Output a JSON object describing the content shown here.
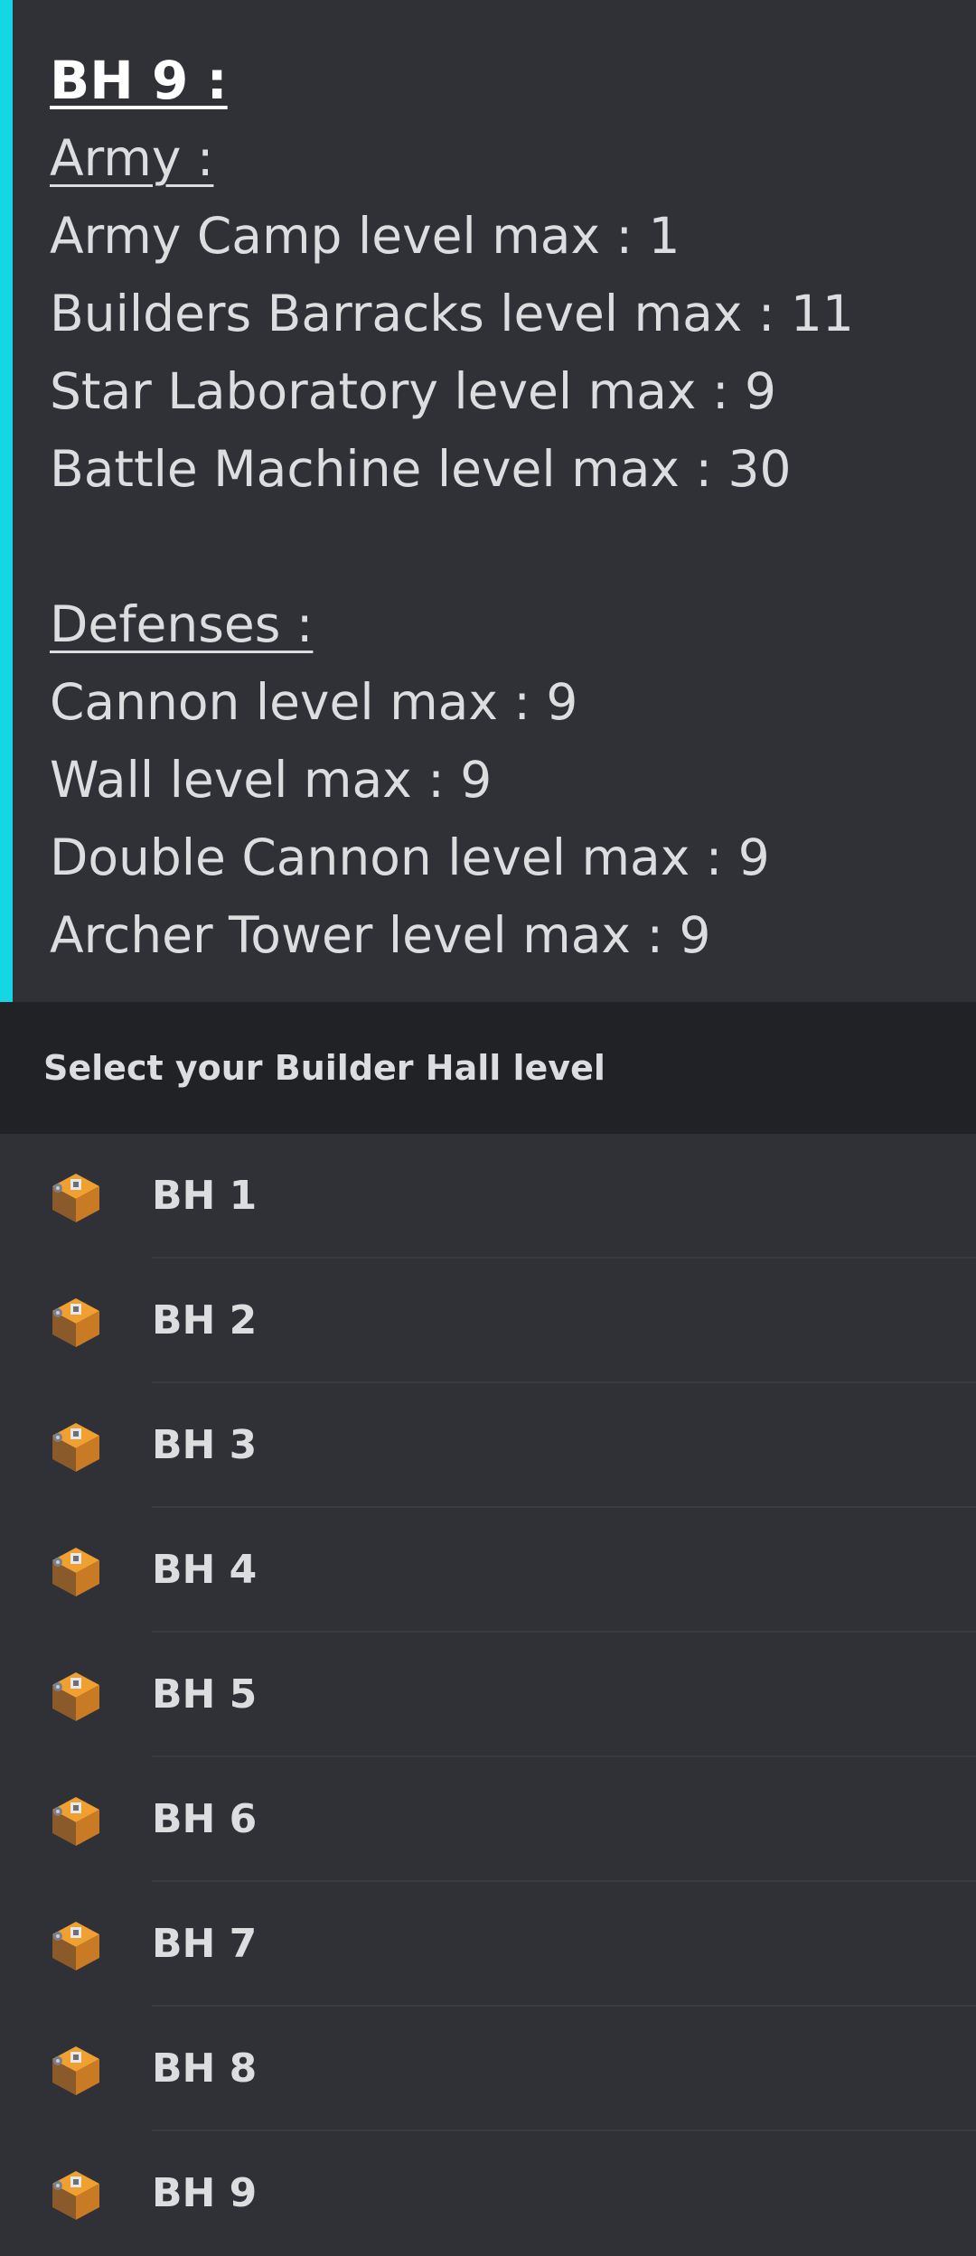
{
  "embed": {
    "accent_color": "#14d6e4",
    "title": "BH 9 :",
    "army_heading": "Army :",
    "army_lines": [
      "Army Camp level max : 1",
      "Builders Barracks level max : 11",
      "Star Laboratory level max : 9",
      "Battle Machine level max : 30"
    ],
    "defenses_heading": "Defenses :",
    "defense_lines": [
      "Cannon level max : 9",
      "Wall level max : 9",
      "Double Cannon level max : 9",
      "Archer Tower level max : 9"
    ]
  },
  "select_menu": {
    "title": "Select your Builder Hall level",
    "options": [
      {
        "label": "BH 1",
        "icon": "builder-hall-1-icon"
      },
      {
        "label": "BH 2",
        "icon": "builder-hall-2-icon"
      },
      {
        "label": "BH 3",
        "icon": "builder-hall-3-icon"
      },
      {
        "label": "BH 4",
        "icon": "builder-hall-4-icon"
      },
      {
        "label": "BH 5",
        "icon": "builder-hall-5-icon"
      },
      {
        "label": "BH 6",
        "icon": "builder-hall-6-icon"
      },
      {
        "label": "BH 7",
        "icon": "builder-hall-7-icon"
      },
      {
        "label": "BH 8",
        "icon": "builder-hall-8-icon"
      },
      {
        "label": "BH 9",
        "icon": "builder-hall-9-icon"
      }
    ]
  }
}
